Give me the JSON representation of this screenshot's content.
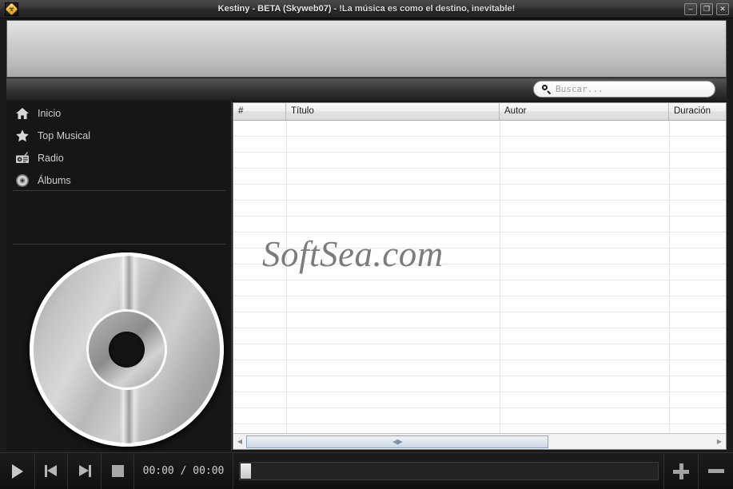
{
  "window": {
    "title": "Kestiny - BETA (Skyweb07)",
    "subtitle": "- !La música es como el destino, inevitable!",
    "app_icon": "hazard-diamond-icon",
    "controls": {
      "minimize": "–",
      "maximize": "❐",
      "close": "✕"
    }
  },
  "search": {
    "placeholder": "Buscar...",
    "value": "",
    "icon": "search-icon"
  },
  "sidebar": {
    "items": [
      {
        "label": "Inicio",
        "icon": "home-icon"
      },
      {
        "label": "Top Musical",
        "icon": "star-icon"
      },
      {
        "label": "Radio",
        "icon": "radio-icon"
      },
      {
        "label": "Álbums",
        "icon": "cd-icon"
      }
    ],
    "album_art": "compact-disc-icon"
  },
  "table": {
    "columns": [
      "#",
      "Título",
      "Autor",
      "Duración"
    ],
    "rows": [],
    "watermark": "SoftSea.com",
    "scrollbar": {
      "left_arrow": "◀",
      "right_arrow": "▶",
      "grip": "◀▶"
    }
  },
  "player": {
    "play_label": "play-button",
    "previous_label": "previous-button",
    "next_label": "next-button",
    "stop_label": "stop-button",
    "elapsed": "00:00",
    "separator": "/",
    "total": "00:00",
    "timecode": "00:00  /  00:00",
    "seek_position_percent": 0,
    "add_label": "+",
    "remove_label": "–"
  },
  "colors": {
    "titlebar": "#3a3a3a",
    "panel_dark": "#161616",
    "banner_top": "#e4e4e4",
    "table_bg": "#ffffff",
    "accent_icon": "#f5c33c"
  }
}
